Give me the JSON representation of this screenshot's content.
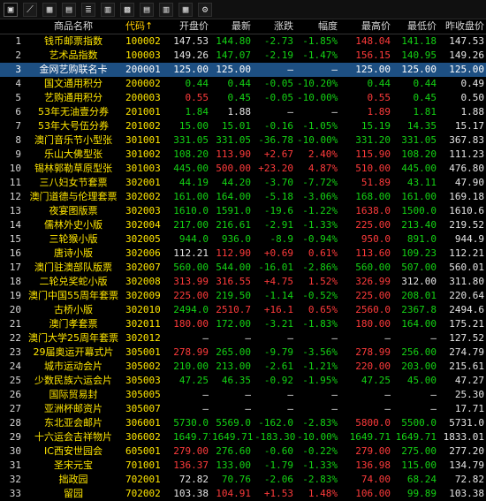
{
  "toolbar": {
    "icons": [
      {
        "name": "mode-toggle-icon",
        "glyph": "▣"
      },
      {
        "name": "trend-chart-icon",
        "glyph": "⟋"
      },
      {
        "name": "grid-view-icon",
        "glyph": "▦"
      },
      {
        "name": "calendar-icon",
        "glyph": "▤"
      },
      {
        "name": "list-icon",
        "glyph": "≣"
      },
      {
        "name": "table-icon",
        "glyph": "▥"
      },
      {
        "name": "layout-icon",
        "glyph": "▩"
      },
      {
        "name": "panel-icon",
        "glyph": "▤"
      },
      {
        "name": "columns-icon",
        "glyph": "▥"
      },
      {
        "name": "toggle-icon",
        "glyph": "▦"
      },
      {
        "name": "settings-icon",
        "glyph": "⚙"
      }
    ]
  },
  "header": {
    "idx": "",
    "name": "商品名称",
    "code": "代码↑",
    "open": "开盘价",
    "latest": "最新",
    "change": "涨跌",
    "pct": "幅度",
    "high": "最高价",
    "low": "最低价",
    "prev_close": "昨收盘价"
  },
  "rows": [
    {
      "idx": "1",
      "name": "钱币邮票指数",
      "code": "100002",
      "open": "147.53",
      "latest": "144.80",
      "change": "-2.73",
      "pct": "-1.85%",
      "high": "148.04",
      "low": "141.18",
      "prev_close": "147.53",
      "colors": {
        "open": "c-white",
        "latest": "c-green",
        "change": "c-green",
        "pct": "c-green",
        "high": "c-red",
        "low": "c-green",
        "prev_close": "c-white"
      }
    },
    {
      "idx": "2",
      "name": "艺术品指数",
      "code": "100003",
      "open": "149.26",
      "latest": "147.07",
      "change": "-2.19",
      "pct": "-1.47%",
      "high": "156.15",
      "low": "140.95",
      "prev_close": "149.26",
      "colors": {
        "open": "c-white",
        "latest": "c-green",
        "change": "c-green",
        "pct": "c-green",
        "high": "c-red",
        "low": "c-green",
        "prev_close": "c-white"
      }
    },
    {
      "idx": "3",
      "name": "金网艺购联名卡",
      "code": "200001",
      "open": "125.00",
      "latest": "125.00",
      "change": "—",
      "pct": "—",
      "high": "125.00",
      "low": "125.00",
      "prev_close": "125.00",
      "selected": true,
      "colors": {
        "open": "c-white",
        "latest": "c-white",
        "change": "c-white",
        "pct": "c-white",
        "high": "c-white",
        "low": "c-white",
        "prev_close": "c-white"
      }
    },
    {
      "idx": "4",
      "name": "国文通用积分",
      "code": "200002",
      "open": "0.44",
      "latest": "0.44",
      "change": "-0.05",
      "pct": "-10.20%",
      "high": "0.44",
      "low": "0.44",
      "prev_close": "0.49",
      "colors": {
        "open": "c-green",
        "latest": "c-green",
        "change": "c-green",
        "pct": "c-green",
        "high": "c-green",
        "low": "c-green",
        "prev_close": "c-white"
      }
    },
    {
      "idx": "5",
      "name": "艺购通用积分",
      "code": "200003",
      "open": "0.55",
      "latest": "0.45",
      "change": "-0.05",
      "pct": "-10.00%",
      "high": "0.55",
      "low": "0.45",
      "prev_close": "0.50",
      "colors": {
        "open": "c-red",
        "latest": "c-green",
        "change": "c-green",
        "pct": "c-green",
        "high": "c-red",
        "low": "c-green",
        "prev_close": "c-white"
      }
    },
    {
      "idx": "6",
      "name": "53年无油壹分券",
      "code": "201001",
      "open": "1.84",
      "latest": "1.88",
      "change": "—",
      "pct": "—",
      "high": "1.89",
      "low": "1.81",
      "prev_close": "1.88",
      "colors": {
        "open": "c-green",
        "latest": "c-white",
        "change": "c-white",
        "pct": "c-white",
        "high": "c-red",
        "low": "c-green",
        "prev_close": "c-white"
      }
    },
    {
      "idx": "7",
      "name": "53年大号伍分券",
      "code": "201002",
      "open": "15.00",
      "latest": "15.01",
      "change": "-0.16",
      "pct": "-1.05%",
      "high": "15.19",
      "low": "14.35",
      "prev_close": "15.17",
      "colors": {
        "open": "c-green",
        "latest": "c-green",
        "change": "c-green",
        "pct": "c-green",
        "high": "c-green",
        "low": "c-green",
        "prev_close": "c-white"
      }
    },
    {
      "idx": "8",
      "name": "澳门音乐节小型张",
      "code": "301001",
      "open": "331.05",
      "latest": "331.05",
      "change": "-36.78",
      "pct": "-10.00%",
      "high": "331.20",
      "low": "331.05",
      "prev_close": "367.83",
      "colors": {
        "open": "c-green",
        "latest": "c-green",
        "change": "c-green",
        "pct": "c-green",
        "high": "c-green",
        "low": "c-green",
        "prev_close": "c-white"
      }
    },
    {
      "idx": "9",
      "name": "乐山大佛型张",
      "code": "301002",
      "open": "108.20",
      "latest": "113.90",
      "change": "+2.67",
      "pct": "2.40%",
      "high": "115.90",
      "low": "108.20",
      "prev_close": "111.23",
      "colors": {
        "open": "c-green",
        "latest": "c-red",
        "change": "c-red",
        "pct": "c-red",
        "high": "c-red",
        "low": "c-green",
        "prev_close": "c-white"
      }
    },
    {
      "idx": "10",
      "name": "锡林郭勒草原型张",
      "code": "301003",
      "open": "445.00",
      "latest": "500.00",
      "change": "+23.20",
      "pct": "4.87%",
      "high": "510.00",
      "low": "445.00",
      "prev_close": "476.80",
      "colors": {
        "open": "c-green",
        "latest": "c-red",
        "change": "c-red",
        "pct": "c-red",
        "high": "c-red",
        "low": "c-green",
        "prev_close": "c-white"
      }
    },
    {
      "idx": "11",
      "name": "三八妇女节套票",
      "code": "302001",
      "open": "44.19",
      "latest": "44.20",
      "change": "-3.70",
      "pct": "-7.72%",
      "high": "51.89",
      "low": "43.11",
      "prev_close": "47.90",
      "colors": {
        "open": "c-green",
        "latest": "c-green",
        "change": "c-green",
        "pct": "c-green",
        "high": "c-red",
        "low": "c-green",
        "prev_close": "c-white"
      }
    },
    {
      "idx": "12",
      "name": "澳门道德与伦理套票",
      "code": "302002",
      "open": "161.00",
      "latest": "164.00",
      "change": "-5.18",
      "pct": "-3.06%",
      "high": "168.00",
      "low": "161.00",
      "prev_close": "169.18",
      "colors": {
        "open": "c-green",
        "latest": "c-green",
        "change": "c-green",
        "pct": "c-green",
        "high": "c-green",
        "low": "c-green",
        "prev_close": "c-white"
      }
    },
    {
      "idx": "13",
      "name": "夜宴图版票",
      "code": "302003",
      "open": "1610.0",
      "latest": "1591.0",
      "change": "-19.6",
      "pct": "-1.22%",
      "high": "1638.0",
      "low": "1500.0",
      "prev_close": "1610.6",
      "colors": {
        "open": "c-green",
        "latest": "c-green",
        "change": "c-green",
        "pct": "c-green",
        "high": "c-red",
        "low": "c-green",
        "prev_close": "c-white"
      }
    },
    {
      "idx": "14",
      "name": "儒林外史小版",
      "code": "302004",
      "open": "217.00",
      "latest": "216.61",
      "change": "-2.91",
      "pct": "-1.33%",
      "high": "225.00",
      "low": "213.40",
      "prev_close": "219.52",
      "colors": {
        "open": "c-green",
        "latest": "c-green",
        "change": "c-green",
        "pct": "c-green",
        "high": "c-red",
        "low": "c-green",
        "prev_close": "c-white"
      }
    },
    {
      "idx": "15",
      "name": "三轮猴小版",
      "code": "302005",
      "open": "944.0",
      "latest": "936.0",
      "change": "-8.9",
      "pct": "-0.94%",
      "high": "950.0",
      "low": "891.0",
      "prev_close": "944.9",
      "colors": {
        "open": "c-green",
        "latest": "c-green",
        "change": "c-green",
        "pct": "c-green",
        "high": "c-red",
        "low": "c-green",
        "prev_close": "c-white"
      }
    },
    {
      "idx": "16",
      "name": "唐诗小版",
      "code": "302006",
      "open": "112.21",
      "latest": "112.90",
      "change": "+0.69",
      "pct": "0.61%",
      "high": "113.60",
      "low": "109.23",
      "prev_close": "112.21",
      "colors": {
        "open": "c-white",
        "latest": "c-red",
        "change": "c-red",
        "pct": "c-red",
        "high": "c-red",
        "low": "c-green",
        "prev_close": "c-white"
      }
    },
    {
      "idx": "17",
      "name": "澳门驻澳部队版票",
      "code": "302007",
      "open": "560.00",
      "latest": "544.00",
      "change": "-16.01",
      "pct": "-2.86%",
      "high": "560.00",
      "low": "507.00",
      "prev_close": "560.01",
      "colors": {
        "open": "c-green",
        "latest": "c-green",
        "change": "c-green",
        "pct": "c-green",
        "high": "c-green",
        "low": "c-green",
        "prev_close": "c-white"
      }
    },
    {
      "idx": "18",
      "name": "二轮兑奖蛇小版",
      "code": "302008",
      "open": "313.99",
      "latest": "316.55",
      "change": "+4.75",
      "pct": "1.52%",
      "high": "326.99",
      "low": "312.00",
      "prev_close": "311.80",
      "colors": {
        "open": "c-red",
        "latest": "c-red",
        "change": "c-red",
        "pct": "c-red",
        "high": "c-red",
        "low": "c-white",
        "prev_close": "c-white"
      }
    },
    {
      "idx": "19",
      "name": "澳门中国55周年套票",
      "code": "302009",
      "open": "225.00",
      "latest": "219.50",
      "change": "-1.14",
      "pct": "-0.52%",
      "high": "225.00",
      "low": "208.01",
      "prev_close": "220.64",
      "colors": {
        "open": "c-red",
        "latest": "c-green",
        "change": "c-green",
        "pct": "c-green",
        "high": "c-red",
        "low": "c-green",
        "prev_close": "c-white"
      }
    },
    {
      "idx": "20",
      "name": "古桥小版",
      "code": "302010",
      "open": "2494.0",
      "latest": "2510.7",
      "change": "+16.1",
      "pct": "0.65%",
      "high": "2560.0",
      "low": "2367.8",
      "prev_close": "2494.6",
      "colors": {
        "open": "c-green",
        "latest": "c-red",
        "change": "c-red",
        "pct": "c-red",
        "high": "c-red",
        "low": "c-green",
        "prev_close": "c-white"
      }
    },
    {
      "idx": "21",
      "name": "澳门孝套票",
      "code": "302011",
      "open": "180.00",
      "latest": "172.00",
      "change": "-3.21",
      "pct": "-1.83%",
      "high": "180.00",
      "low": "164.00",
      "prev_close": "175.21",
      "colors": {
        "open": "c-red",
        "latest": "c-green",
        "change": "c-green",
        "pct": "c-green",
        "high": "c-red",
        "low": "c-green",
        "prev_close": "c-white"
      }
    },
    {
      "idx": "22",
      "name": "澳门大学25周年套票",
      "code": "302012",
      "open": "—",
      "latest": "—",
      "change": "—",
      "pct": "—",
      "high": "—",
      "low": "—",
      "prev_close": "127.52",
      "colors": {
        "open": "c-white",
        "latest": "c-white",
        "change": "c-white",
        "pct": "c-white",
        "high": "c-white",
        "low": "c-white",
        "prev_close": "c-white"
      }
    },
    {
      "idx": "23",
      "name": "29届奥运开幕式片",
      "code": "305001",
      "open": "278.99",
      "latest": "265.00",
      "change": "-9.79",
      "pct": "-3.56%",
      "high": "278.99",
      "low": "256.00",
      "prev_close": "274.79",
      "colors": {
        "open": "c-red",
        "latest": "c-green",
        "change": "c-green",
        "pct": "c-green",
        "high": "c-red",
        "low": "c-green",
        "prev_close": "c-white"
      }
    },
    {
      "idx": "24",
      "name": "城市运动会片",
      "code": "305002",
      "open": "210.00",
      "latest": "213.00",
      "change": "-2.61",
      "pct": "-1.21%",
      "high": "220.00",
      "low": "203.00",
      "prev_close": "215.61",
      "colors": {
        "open": "c-green",
        "latest": "c-green",
        "change": "c-green",
        "pct": "c-green",
        "high": "c-red",
        "low": "c-green",
        "prev_close": "c-white"
      }
    },
    {
      "idx": "25",
      "name": "少数民族六运会片",
      "code": "305003",
      "open": "47.25",
      "latest": "46.35",
      "change": "-0.92",
      "pct": "-1.95%",
      "high": "47.25",
      "low": "45.00",
      "prev_close": "47.27",
      "colors": {
        "open": "c-green",
        "latest": "c-green",
        "change": "c-green",
        "pct": "c-green",
        "high": "c-green",
        "low": "c-green",
        "prev_close": "c-white"
      }
    },
    {
      "idx": "26",
      "name": "国际贸易封",
      "code": "305005",
      "open": "—",
      "latest": "—",
      "change": "—",
      "pct": "—",
      "high": "—",
      "low": "—",
      "prev_close": "25.30",
      "colors": {
        "open": "c-white",
        "latest": "c-white",
        "change": "c-white",
        "pct": "c-white",
        "high": "c-white",
        "low": "c-white",
        "prev_close": "c-white"
      }
    },
    {
      "idx": "27",
      "name": "亚洲杯邮资片",
      "code": "305007",
      "open": "—",
      "latest": "—",
      "change": "—",
      "pct": "—",
      "high": "—",
      "low": "—",
      "prev_close": "17.71",
      "colors": {
        "open": "c-white",
        "latest": "c-white",
        "change": "c-white",
        "pct": "c-white",
        "high": "c-white",
        "low": "c-white",
        "prev_close": "c-white"
      }
    },
    {
      "idx": "28",
      "name": "东北亚会邮片",
      "code": "306001",
      "open": "5730.0",
      "latest": "5569.0",
      "change": "-162.0",
      "pct": "-2.83%",
      "high": "5800.0",
      "low": "5500.0",
      "prev_close": "5731.0",
      "colors": {
        "open": "c-green",
        "latest": "c-green",
        "change": "c-green",
        "pct": "c-green",
        "high": "c-red",
        "low": "c-green",
        "prev_close": "c-white"
      }
    },
    {
      "idx": "29",
      "name": "十六运会吉祥物片",
      "code": "306002",
      "open": "1649.71",
      "latest": "1649.71",
      "change": "-183.30",
      "pct": "-10.00%",
      "high": "1649.71",
      "low": "1649.71",
      "prev_close": "1833.01",
      "colors": {
        "open": "c-green",
        "latest": "c-green",
        "change": "c-green",
        "pct": "c-green",
        "high": "c-green",
        "low": "c-green",
        "prev_close": "c-white"
      }
    },
    {
      "idx": "30",
      "name": "IC西安世园会",
      "code": "605001",
      "open": "279.00",
      "latest": "276.60",
      "change": "-0.60",
      "pct": "-0.22%",
      "high": "279.00",
      "low": "275.00",
      "prev_close": "277.20",
      "colors": {
        "open": "c-red",
        "latest": "c-green",
        "change": "c-green",
        "pct": "c-green",
        "high": "c-red",
        "low": "c-green",
        "prev_close": "c-white"
      }
    },
    {
      "idx": "31",
      "name": "圣宋元宝",
      "code": "701001",
      "open": "136.37",
      "latest": "133.00",
      "change": "-1.79",
      "pct": "-1.33%",
      "high": "136.98",
      "low": "115.00",
      "prev_close": "134.79",
      "colors": {
        "open": "c-red",
        "latest": "c-green",
        "change": "c-green",
        "pct": "c-green",
        "high": "c-red",
        "low": "c-green",
        "prev_close": "c-white"
      }
    },
    {
      "idx": "32",
      "name": "拙政园",
      "code": "702001",
      "open": "72.82",
      "latest": "70.76",
      "change": "-2.06",
      "pct": "-2.83%",
      "high": "74.00",
      "low": "68.24",
      "prev_close": "72.82",
      "colors": {
        "open": "c-white",
        "latest": "c-green",
        "change": "c-green",
        "pct": "c-green",
        "high": "c-red",
        "low": "c-green",
        "prev_close": "c-white"
      }
    },
    {
      "idx": "33",
      "name": "留园",
      "code": "702002",
      "open": "103.38",
      "latest": "104.91",
      "change": "+1.53",
      "pct": "1.48%",
      "high": "106.00",
      "low": "99.89",
      "prev_close": "103.38",
      "colors": {
        "open": "c-white",
        "latest": "c-red",
        "change": "c-red",
        "pct": "c-red",
        "high": "c-red",
        "low": "c-green",
        "prev_close": "c-white"
      }
    }
  ]
}
